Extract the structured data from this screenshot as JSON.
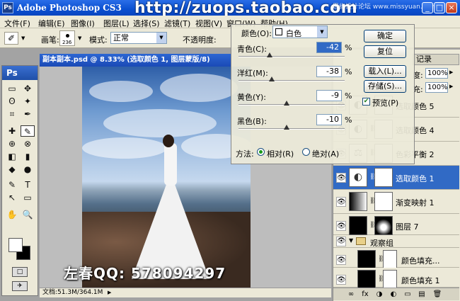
{
  "window": {
    "logo": "Ps",
    "title": "Adobe Photoshop CS3",
    "watermark_url": "http://zuops.taobao.com",
    "watermark_site": "思缘设计论坛 www.missyuan.com",
    "minimize": "_",
    "maximize": "□",
    "close": "×"
  },
  "menu": [
    "文件(F)",
    "编辑(E)",
    "图像(I)",
    "图层(L)",
    "选择(S)",
    "滤镜(T)",
    "视图(V)",
    "窗口(W)",
    "帮助(H)"
  ],
  "options": {
    "brush_icon": "✐",
    "brush_label": "画笔:",
    "brush_size": "236",
    "mode_label": "模式:",
    "mode_value": "正常",
    "opacity_label": "不透明度:"
  },
  "toolbox": {
    "header": "Ps",
    "tools": [
      "▭",
      "✥",
      "ʘ",
      "✦",
      "⌗",
      "✒",
      "✚",
      "✎",
      "⊕",
      "⊗",
      "◧",
      "▮",
      "◆",
      "●",
      "✎",
      "T",
      "↖",
      "▭",
      "✋",
      "🔍",
      "□",
      "✈"
    ]
  },
  "document": {
    "title": "副本副本.psd @ 8.33% (选取颜色 1, 图层蒙版/8)",
    "status": "文档:51.3M/364.1M"
  },
  "watermark_qq": "左春QQ: 578094297",
  "dialog": {
    "color_label": "颜色(O):",
    "color_value": "白色",
    "sliders": [
      {
        "label": "青色(C):",
        "value": "-42",
        "percent": -42,
        "active": true
      },
      {
        "label": "洋红(M):",
        "value": "-38",
        "percent": -38,
        "active": false
      },
      {
        "label": "黄色(Y):",
        "value": "-9",
        "percent": -9,
        "active": false
      },
      {
        "label": "黑色(B):",
        "value": "-10",
        "percent": -10,
        "active": false
      }
    ],
    "pct": "%",
    "method_label": "方法:",
    "method_relative": "相对(R)",
    "method_absolute": "绝对(A)",
    "ok": "确定",
    "reset": "复位",
    "load": "载入(L)...",
    "save": "存储(S)...",
    "preview": "预览(P)",
    "preview_checked": true
  },
  "layers_panel": {
    "history_tab": "记录",
    "opacity_label": "度:",
    "opacity_value": "100%",
    "fill_label": "充:",
    "fill_value": "100%",
    "layers": [
      {
        "name": "选取颜色 5",
        "type": "adj",
        "selected": false
      },
      {
        "name": "选取颜色 4",
        "type": "adj",
        "selected": false
      },
      {
        "name": "色彩平衡 2",
        "type": "adj",
        "selected": false
      },
      {
        "name": "选取颜色 1",
        "type": "adj",
        "selected": true
      },
      {
        "name": "渐变映射 1",
        "type": "grad",
        "selected": false
      },
      {
        "name": "图层 7",
        "type": "black",
        "selected": false
      }
    ],
    "group_name": "观察组",
    "group_layers": [
      {
        "name": "颜色填充...",
        "type": "black"
      },
      {
        "name": "颜色填充 1",
        "type": "black"
      }
    ],
    "footer_icons": [
      "∞",
      "fx",
      "◑",
      "◐",
      "▭",
      "▤",
      "🗑"
    ]
  }
}
